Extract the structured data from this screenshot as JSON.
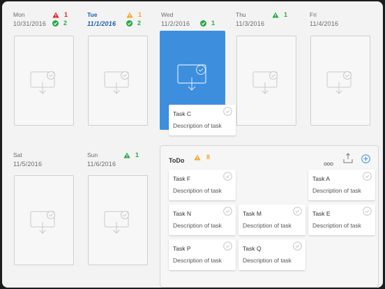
{
  "week": [
    {
      "name": "Mon",
      "date": "10/31/2016",
      "warn": "1",
      "warn_color": "#e02020",
      "ok": "2"
    },
    {
      "name": "Tue",
      "date": "11/1/2016",
      "warn": "1",
      "warn_color": "#f5a623",
      "ok": "2"
    },
    {
      "name": "Wed",
      "date": "11/2/2016",
      "ok": "1"
    },
    {
      "name": "Thu",
      "date": "11/3/2016",
      "ok": "1"
    },
    {
      "name": "Fri",
      "date": "11/4/2016"
    },
    {
      "name": "Sat",
      "date": "11/5/2016"
    },
    {
      "name": "Sun",
      "date": "11/6/2016",
      "ok": "1"
    }
  ],
  "floating_card": {
    "title": "Task C",
    "desc": "Description of task"
  },
  "todo": {
    "title": "ToDo",
    "count": "8",
    "tasks": [
      {
        "title": "Task F",
        "desc": "Description of task"
      },
      {
        "title": "Task A",
        "desc": "Description of task"
      },
      {
        "title": "Task N",
        "desc": "Description of task"
      },
      {
        "title": "Task M",
        "desc": "Description of task"
      },
      {
        "title": "Task E",
        "desc": "Description of task"
      },
      {
        "title": "Task P",
        "desc": "Description of task"
      },
      {
        "title": "Task Q",
        "desc": "Description of task"
      }
    ]
  },
  "colors": {
    "accent": "#3d8fde",
    "ok": "#27a844",
    "warn_red": "#e02020",
    "warn_orange": "#f5a623",
    "today": "#1d5fa8"
  },
  "icons": {
    "warn": "warning-triangle-icon",
    "ok": "check-circle-icon",
    "drop": "drop-target-icon",
    "more": "more-icon",
    "share": "share-icon",
    "add": "add-icon"
  }
}
